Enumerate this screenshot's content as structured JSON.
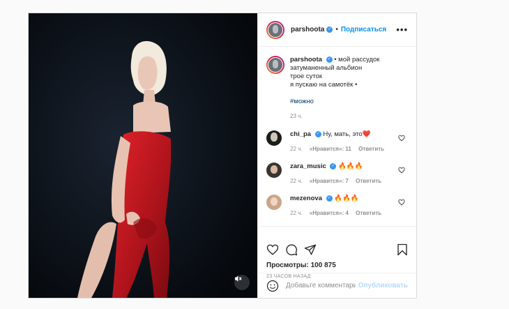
{
  "post": {
    "username": "parshoota",
    "follow_label": "Подписаться",
    "dot": "•",
    "more_glyph": "•••",
    "caption": {
      "lines": [
        "• мой рассудок",
        "затуманенный альбион",
        "трое суток",
        "я пускаю на самотёк •"
      ],
      "hashtag": "#можно",
      "time": "23 ч."
    },
    "comments": [
      {
        "username": "chi_pa",
        "text": "Ну, мать, это❤️",
        "time": "22 ч.",
        "likes": "«Нравится»: 11",
        "reply": "Ответить"
      },
      {
        "username": "zara_music",
        "text": "🔥🔥🔥",
        "time": "22 ч.",
        "likes": "«Нравится»: 7",
        "reply": "Ответить"
      },
      {
        "username": "mezenova",
        "text": "🔥🔥🔥",
        "time": "22 ч.",
        "likes": "«Нравится»: 4",
        "reply": "Ответить"
      }
    ],
    "views": "Просмотры: 100 875",
    "time_ago": "23 ЧАСОВ НАЗАД",
    "comment_placeholder": "Добавьте комментарий...",
    "publish_label": "Опубликовать",
    "icons": [
      "heart-icon",
      "comment-icon",
      "share-icon",
      "bookmark-icon",
      "emoji-icon",
      "mute-icon",
      "verified-icon"
    ]
  }
}
